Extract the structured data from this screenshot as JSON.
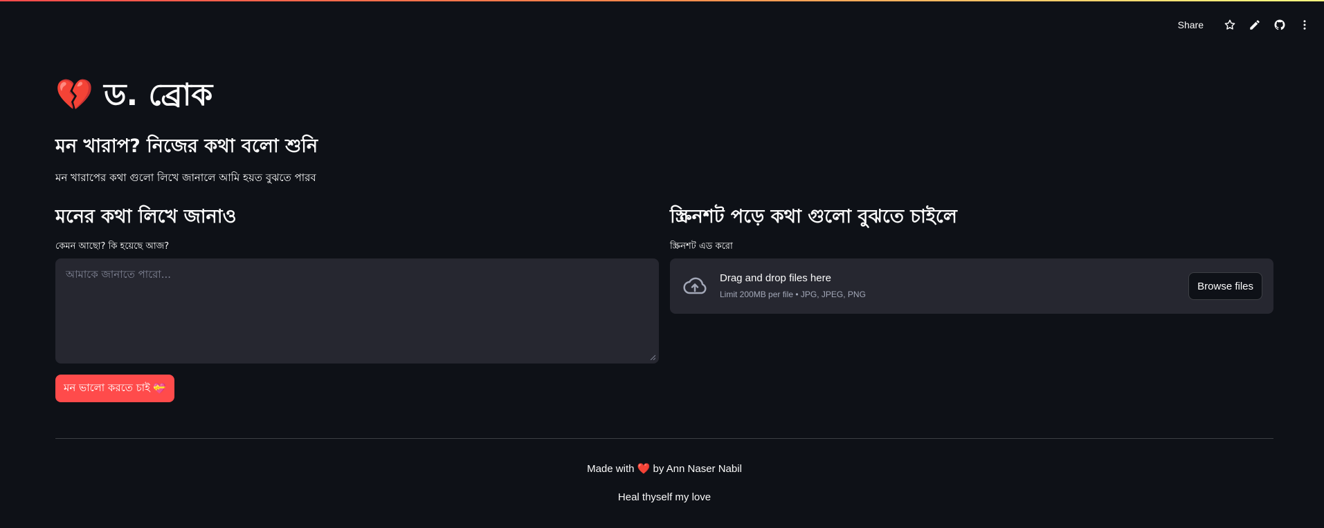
{
  "toolbar": {
    "share_label": "Share",
    "icons": [
      "star-icon",
      "edit-icon",
      "github-icon",
      "more-vertical-icon"
    ]
  },
  "page": {
    "title_emoji": "💔",
    "title": "ড. ব্রোক",
    "subtitle": "মন খারাপ? নিজের কথা বলো শুনি",
    "description": "মন খারাপের কথা গুলো লিখে জানালে আমি হয়ত বুঝতে পারব"
  },
  "left_column": {
    "heading": "মনের কথা লিখে জানাও",
    "input_label": "কেমন আছো? কি হয়েছে আজ?",
    "input_placeholder": "আমাকে জানাতে পারো...",
    "input_value": "",
    "submit_label": "মন ভালো করতে চাই",
    "submit_emoji": "💝"
  },
  "right_column": {
    "heading": "স্ক্রিনশট পড়ে কথা গুলো বুঝতে চাইলে",
    "upload_label": "স্ক্রিনশট এড করো",
    "dropzone_title": "Drag and drop files here",
    "dropzone_limit": "Limit 200MB per file • JPG, JPEG, PNG",
    "browse_label": "Browse files"
  },
  "footer": {
    "made_prefix": "Made with",
    "heart": "❤️",
    "made_suffix": "by Ann Naser Nabil",
    "tagline": "Heal thyself my love"
  },
  "colors": {
    "background": "#0e1117",
    "input_bg": "#262730",
    "primary": "#ff4b4b",
    "text": "#fafafa"
  }
}
